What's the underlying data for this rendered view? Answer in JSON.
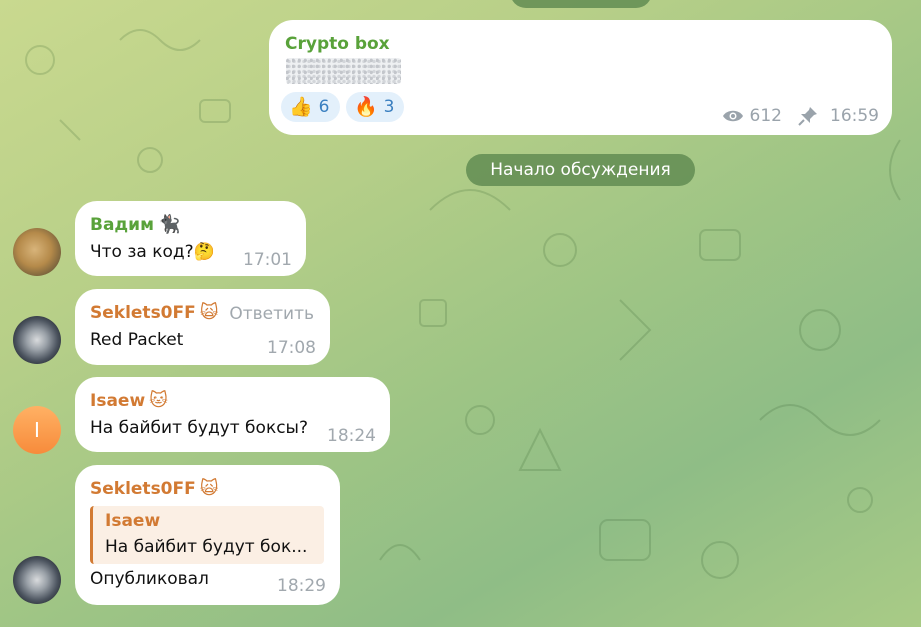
{
  "top_pill": "",
  "channel_post": {
    "name": "Crypto box",
    "reactions": [
      {
        "emoji": "👍",
        "count": "6"
      },
      {
        "emoji": "🔥",
        "count": "3"
      }
    ],
    "views": "612",
    "time": "16:59"
  },
  "divider": "Начало обсуждения",
  "messages": [
    {
      "sender": "Вадим",
      "badge": "🐈‍⬛",
      "text": "Что за код?🤔",
      "time": "17:01",
      "avatar_letter": ""
    },
    {
      "sender": "Sekl​ets0FF",
      "badge": "🙀",
      "reply_label": "Ответить",
      "text": "Red Packet",
      "time": "17:08"
    },
    {
      "sender": "Isaew",
      "badge": "🐱",
      "text": "На байбит будут боксы?",
      "time": "18:24",
      "avatar_letter": "I"
    },
    {
      "sender": "Sekl​ets0FF",
      "badge": "🙀",
      "quote_name": "Isaew",
      "quote_text": "На байбит будут бок...",
      "text": "Опубликовал",
      "time": "18:29"
    }
  ],
  "colors": {
    "green_name": "#59a23a",
    "orange_name": "#d27a33",
    "reaction_bg": "#e3f0fb",
    "reaction_text": "#3a7fc0"
  }
}
